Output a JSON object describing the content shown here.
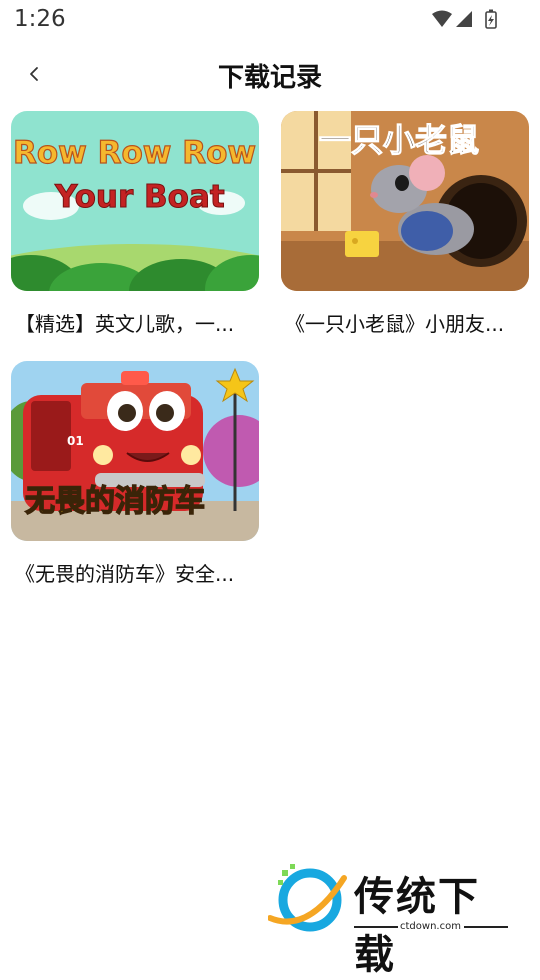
{
  "status": {
    "time": "1:26"
  },
  "header": {
    "title": "下载记录"
  },
  "cards": [
    {
      "title": "【精选】英文儿歌，一...",
      "thumb_line1": "Row Row Row",
      "thumb_line2": "Your Boat"
    },
    {
      "title": "《一只小老鼠》小朋友...",
      "thumb_text": "一只小老鼠"
    },
    {
      "title": "《无畏的消防车》安全...",
      "thumb_text": "无畏的消防车",
      "truck_number": "01"
    }
  ],
  "watermark": {
    "brand": "传统下载",
    "url": "ctdown.com"
  },
  "colors": {
    "accent_yellow": "#f5c518",
    "truck_red": "#d62a2a",
    "sky_teal": "#8fe3cf"
  }
}
